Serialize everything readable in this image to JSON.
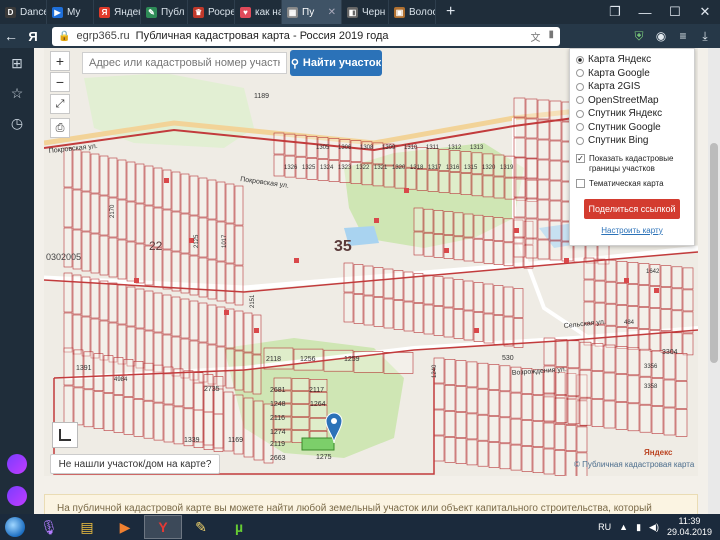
{
  "tabs": [
    {
      "label": "Dance",
      "fav_letter": "D",
      "fav_color": "#3a3a3a"
    },
    {
      "label": "My",
      "fav_letter": "▶",
      "fav_color": "#1e6fd9"
    },
    {
      "label": "Яндекс",
      "fav_letter": "Я",
      "fav_color": "#e03a2a"
    },
    {
      "label": "Публ",
      "fav_letter": "✎",
      "fav_color": "#2e8b57"
    },
    {
      "label": "Росрее",
      "fav_letter": "♛",
      "fav_color": "#c0392b"
    },
    {
      "label": "как на",
      "fav_letter": "♥",
      "fav_color": "#e04a5a"
    },
    {
      "label": "Пу",
      "fav_letter": "▦",
      "fav_color": "#888888",
      "active": true
    },
    {
      "label": "Черн",
      "fav_letter": "◧",
      "fav_color": "#666666"
    },
    {
      "label": "Волос",
      "fav_letter": "▣",
      "fav_color": "#b07030"
    }
  ],
  "browser": {
    "yandex_letter": "Я",
    "url_domain": "egrp365.ru",
    "page_title": "Публичная кадастровая карта - Россия 2019 года"
  },
  "map": {
    "search_placeholder": "Адрес или кадастровый номер участка",
    "search_button": "Найти участок",
    "zoom_in": "+",
    "zoom_out": "−",
    "not_found": "Не нашли участок/дом на карте?",
    "attribution": "© Публичная кадастровая карта",
    "yandex_mark": "Яндекс",
    "labels": {
      "block_35": "35",
      "block_22": "22",
      "code": "0302005",
      "street_1": "Покровская ул.",
      "street_2": "Покровская ул.",
      "street_3": "Сельская ул.",
      "street_4": "Возрождения ул.",
      "p1189": "1189",
      "p1275": "1275",
      "p1274": "1274",
      "p2663": "2663",
      "p1256": "1256",
      "p1259": "1259",
      "p2118": "2118",
      "p2117": "2117",
      "p1264": "1264",
      "p2681": "2681",
      "p1248": "1248",
      "p2116": "2116",
      "p2119": "2119",
      "p2735": "2735",
      "p1169": "1169",
      "p1339": "1339",
      "p1391": "1391",
      "p530": "530",
      "p3304": "3304",
      "p1305": "1305",
      "p1306": "1306",
      "p1308": "1308",
      "p1309": "1309",
      "p1310": "1310",
      "p1311": "1311",
      "p1312": "1312",
      "p1313": "1313",
      "p1315": "1315",
      "p1320": "1320",
      "p1319": "1319",
      "p1316": "1316",
      "p1326": "1326",
      "p1325": "1325",
      "p1324": "1324",
      "p1323": "1323",
      "p1322": "1322",
      "p1321": "1321",
      "p1318": "1318",
      "p1317": "1317",
      "p2170": "2170",
      "p2125": "2125",
      "p1017": "1017",
      "p2151": "2151",
      "p3356": "3356",
      "p3358": "3358",
      "p1642": "1642",
      "p1240": "1240",
      "p484": "484",
      "p4984": "4984",
      "p1320b": "1320"
    }
  },
  "layer_panel": {
    "options": [
      {
        "label": "Карта Яндекс",
        "selected": true
      },
      {
        "label": "Карта Google",
        "selected": false
      },
      {
        "label": "Карта 2GIS",
        "selected": false
      },
      {
        "label": "OpenStreetMap",
        "selected": false
      },
      {
        "label": "Спутник Яндекс",
        "selected": false
      },
      {
        "label": "Спутник Google",
        "selected": false
      },
      {
        "label": "Спутник Bing",
        "selected": false
      }
    ],
    "show_cadastral": "Показать кадастровые границы участков",
    "show_cadastral_checked": true,
    "thematic": "Тематическая карта",
    "thematic_checked": false,
    "share_button": "Поделиться ссылкой",
    "configure_link": "Настроить карту"
  },
  "infobox_text": "На публичной кадастровой карте вы можете найти любой земельный участок или объект капитального строительства, который",
  "taskbar": {
    "lang": "RU",
    "time": "11:39",
    "date": "29.04.2019"
  },
  "colors": {
    "parcel_line": "#b8383a",
    "block_line": "#c23b3c",
    "green": "#cfe6b4",
    "water": "#a9d3f0",
    "accent": "#2b72b8"
  }
}
